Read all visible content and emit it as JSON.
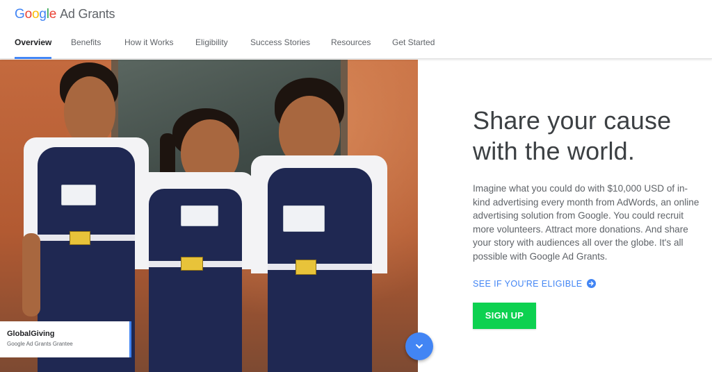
{
  "brand": {
    "logo_letters": [
      {
        "char": "G",
        "color": "#4285F4"
      },
      {
        "char": "o",
        "color": "#EA4335"
      },
      {
        "char": "o",
        "color": "#FBBC05"
      },
      {
        "char": "g",
        "color": "#4285F4"
      },
      {
        "char": "l",
        "color": "#34A853"
      },
      {
        "char": "e",
        "color": "#EA4335"
      }
    ],
    "product": "Ad Grants"
  },
  "nav": {
    "items": [
      {
        "label": "Overview",
        "active": true
      },
      {
        "label": "Benefits",
        "active": false
      },
      {
        "label": "How it Works",
        "active": false
      },
      {
        "label": "Eligibility",
        "active": false
      },
      {
        "label": "Success Stories",
        "active": false
      },
      {
        "label": "Resources",
        "active": false
      },
      {
        "label": "Get Started",
        "active": false
      }
    ]
  },
  "hero": {
    "caption_org": "GlobalGiving",
    "caption_sub": "Google Ad Grants Grantee",
    "scroll_icon": "chevron-down-icon"
  },
  "content": {
    "headline_line1": "Share your cause",
    "headline_line2": "with the world.",
    "body": "Imagine what you could do with $10,000 USD of in-kind advertising every month from AdWords, an online advertising solution from Google. You could recruit more volunteers. Attract more donations. And share your story with audiences all over the globe. It's all possible with Google Ad Grants.",
    "eligible_link": "SEE IF YOU'RE ELIGIBLE",
    "eligible_icon": "arrow-right-circle-icon",
    "signup_label": "SIGN UP"
  },
  "colors": {
    "accent_blue": "#4285F4",
    "signup_green": "#0DD150"
  }
}
